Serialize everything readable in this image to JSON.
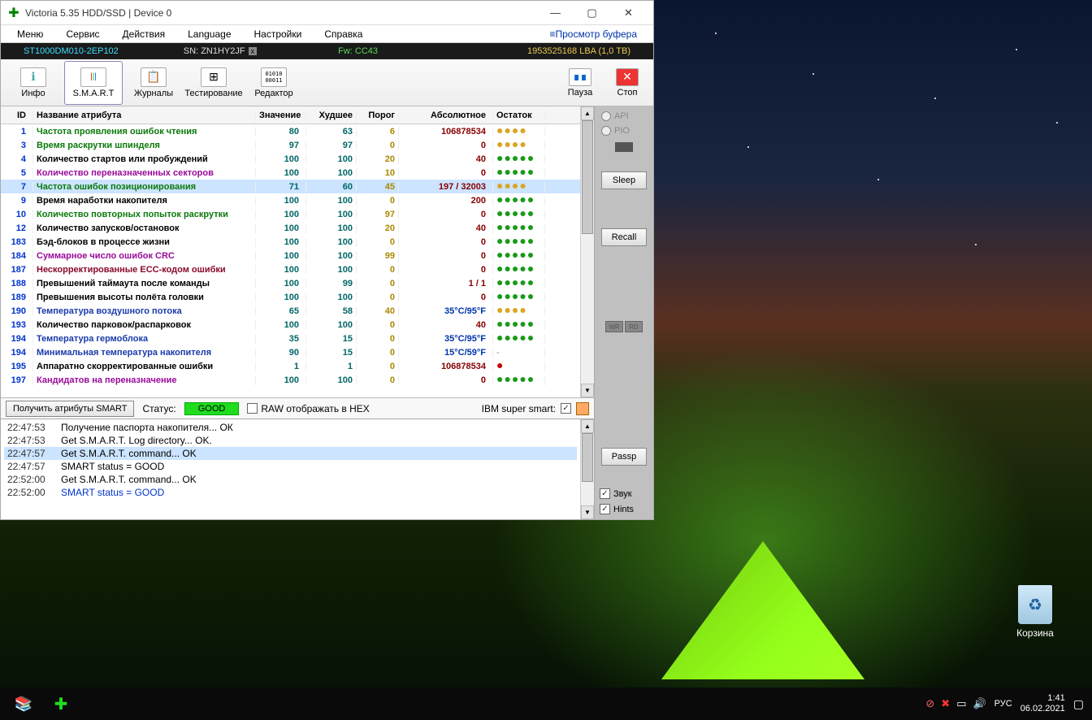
{
  "window": {
    "title": "Victoria 5.35 HDD/SSD | Device 0",
    "menu": [
      "Меню",
      "Сервис",
      "Действия",
      "Language",
      "Настройки",
      "Справка"
    ],
    "menu_right": "Просмотр буфера"
  },
  "info_strip": {
    "model": "ST1000DM010-2EP102",
    "sn": "SN: ZN1HY2JF",
    "fw": "Fw: CC43",
    "lba": "1953525168 LBA (1,0 TB)"
  },
  "toolbar": {
    "info": "Инфо",
    "smart": "S.M.A.R.T",
    "journals": "Журналы",
    "test": "Тестирование",
    "editor": "Редактор",
    "pause": "Пауза",
    "stop": "Стоп"
  },
  "side": {
    "api": "API",
    "pio": "PIO",
    "sleep": "Sleep",
    "recall": "Recall",
    "wr": "WR",
    "rd": "RD",
    "passp": "Passp",
    "sound": "Звук",
    "hints": "Hints"
  },
  "headers": {
    "id": "ID",
    "name": "Название атрибута",
    "val": "Значение",
    "worst": "Худшее",
    "thresh": "Порог",
    "abs": "Абсолютное",
    "health": "Остаток"
  },
  "rows": [
    {
      "id": "1",
      "name": "Частота проявления ошибок чтения",
      "nc": "attr-green",
      "val": "80",
      "worst": "63",
      "t": "6",
      "abs": "106878534",
      "h": "y"
    },
    {
      "id": "3",
      "name": "Время раскрутки шпинделя",
      "nc": "attr-green",
      "val": "97",
      "worst": "97",
      "t": "0",
      "abs": "0",
      "h": "y"
    },
    {
      "id": "4",
      "name": "Количество стартов или пробуждений",
      "nc": "attr-black",
      "val": "100",
      "worst": "100",
      "t": "20",
      "abs": "40",
      "h": "g"
    },
    {
      "id": "5",
      "name": "Количество переназначенных секторов",
      "nc": "attr-purple",
      "val": "100",
      "worst": "100",
      "t": "10",
      "abs": "0",
      "h": "g"
    },
    {
      "id": "7",
      "name": "Частота ошибок позиционирования",
      "nc": "attr-green",
      "val": "71",
      "worst": "60",
      "t": "45",
      "abs": "197 / 32003",
      "h": "y",
      "sel": true
    },
    {
      "id": "9",
      "name": "Время наработки накопителя",
      "nc": "attr-black",
      "val": "100",
      "worst": "100",
      "t": "0",
      "abs": "200",
      "h": "g"
    },
    {
      "id": "10",
      "name": "Количество повторных попыток раскрутки",
      "nc": "attr-green",
      "val": "100",
      "worst": "100",
      "t": "97",
      "abs": "0",
      "h": "g"
    },
    {
      "id": "12",
      "name": "Количество запусков/остановок",
      "nc": "attr-black",
      "val": "100",
      "worst": "100",
      "t": "20",
      "abs": "40",
      "h": "g"
    },
    {
      "id": "183",
      "name": "Бэд-блоков в процессе жизни",
      "nc": "attr-black",
      "val": "100",
      "worst": "100",
      "t": "0",
      "abs": "0",
      "h": "g"
    },
    {
      "id": "184",
      "name": "Суммарное число ошибок CRC",
      "nc": "attr-purple",
      "val": "100",
      "worst": "100",
      "t": "99",
      "abs": "0",
      "h": "g"
    },
    {
      "id": "187",
      "name": "Нескорректированные ECC-кодом ошибки",
      "nc": "attr-darkred",
      "val": "100",
      "worst": "100",
      "t": "0",
      "abs": "0",
      "h": "g"
    },
    {
      "id": "188",
      "name": "Превышений таймаута после команды",
      "nc": "attr-black",
      "val": "100",
      "worst": "99",
      "t": "0",
      "abs": "1 / 1",
      "h": "g"
    },
    {
      "id": "189",
      "name": "Превышения высоты полёта головки",
      "nc": "attr-black",
      "val": "100",
      "worst": "100",
      "t": "0",
      "abs": "0",
      "h": "g"
    },
    {
      "id": "190",
      "name": "Температура воздушного потока",
      "nc": "attr-blue",
      "val": "65",
      "worst": "58",
      "t": "40",
      "abs": "35°C/95°F",
      "ac": "abs-blue",
      "h": "y"
    },
    {
      "id": "193",
      "name": "Количество парковок/распарковок",
      "nc": "attr-black",
      "val": "100",
      "worst": "100",
      "t": "0",
      "abs": "40",
      "h": "g"
    },
    {
      "id": "194",
      "name": "Температура гермоблока",
      "nc": "attr-blue",
      "val": "35",
      "worst": "15",
      "t": "0",
      "abs": "35°C/95°F",
      "ac": "abs-blue",
      "h": "g"
    },
    {
      "id": "194",
      "name": "Минимальная температура накопителя",
      "nc": "attr-blue",
      "val": "90",
      "worst": "15",
      "t": "0",
      "abs": "15°C/59°F",
      "ac": "abs-blue",
      "h": "-"
    },
    {
      "id": "195",
      "name": "Аппаратно скорректированные ошибки",
      "nc": "attr-black",
      "val": "1",
      "worst": "1",
      "t": "0",
      "abs": "106878534",
      "h": "r"
    },
    {
      "id": "197",
      "name": "Кандидатов на переназначение",
      "nc": "attr-purple",
      "val": "100",
      "worst": "100",
      "t": "0",
      "abs": "0",
      "h": "g"
    }
  ],
  "status": {
    "get_btn": "Получить атрибуты SMART",
    "status_label": "Статус:",
    "good": "GOOD",
    "hex": "RAW отображать в HEX",
    "ibm": "IBM super smart:"
  },
  "log": [
    {
      "t": "22:47:53",
      "m": "Получение паспорта накопителя... ОК"
    },
    {
      "t": "22:47:53",
      "m": "Get S.M.A.R.T. Log directory... OK."
    },
    {
      "t": "22:47:57",
      "m": "Get S.M.A.R.T. command... OK",
      "sel": true
    },
    {
      "t": "22:47:57",
      "m": "SMART status = GOOD"
    },
    {
      "t": "22:52:00",
      "m": "Get S.M.A.R.T. command... OK"
    },
    {
      "t": "22:52:00",
      "m": "SMART status = GOOD",
      "blue": true
    }
  ],
  "desktop": {
    "recycle": "Корзина"
  },
  "taskbar": {
    "lang": "РУС",
    "time": "1:41",
    "date": "06.02.2021"
  }
}
